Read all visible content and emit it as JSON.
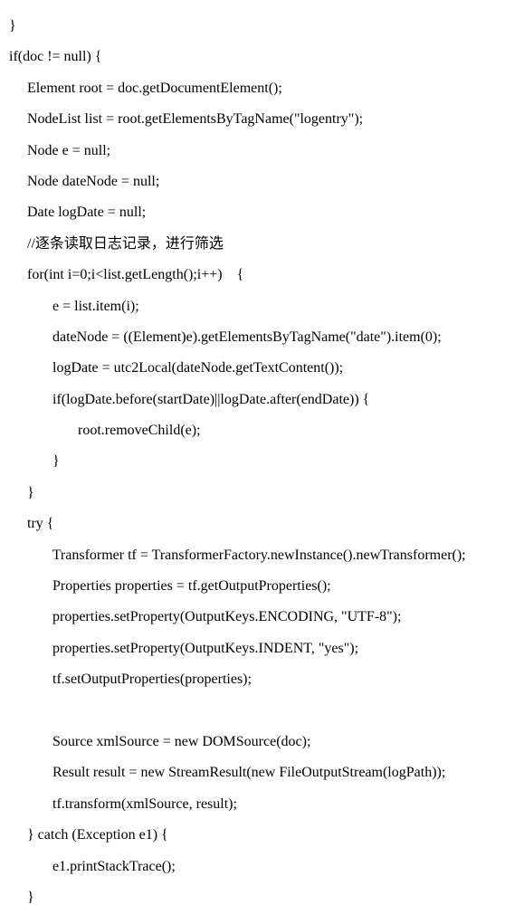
{
  "code": {
    "lines": [
      "}",
      "if(doc != null) {",
      "     Element root = doc.getDocumentElement();",
      "     NodeList list = root.getElementsByTagName(\"logentry\");",
      "     Node e = null;",
      "     Node dateNode = null;",
      "     Date logDate = null;",
      "     //逐条读取日志记录，进行筛选",
      "     for(int i=0;i<list.getLength();i++)    {",
      "            e = list.item(i);",
      "            dateNode = ((Element)e).getElementsByTagName(\"date\").item(0);",
      "            logDate = utc2Local(dateNode.getTextContent());",
      "            if(logDate.before(startDate)||logDate.after(endDate)) {",
      "                   root.removeChild(e);",
      "            }",
      "     }",
      "     try {",
      "            Transformer tf = TransformerFactory.newInstance().newTransformer();",
      "            Properties properties = tf.getOutputProperties();",
      "            properties.setProperty(OutputKeys.ENCODING, \"UTF-8\");",
      "            properties.setProperty(OutputKeys.INDENT, \"yes\");",
      "            tf.setOutputProperties(properties);",
      "",
      "            Source xmlSource = new DOMSource(doc);",
      "            Result result = new StreamResult(new FileOutputStream(logPath));",
      "            tf.transform(xmlSource, result);",
      "     } catch (Exception e1) {",
      "            e1.printStackTrace();",
      "     }"
    ]
  }
}
